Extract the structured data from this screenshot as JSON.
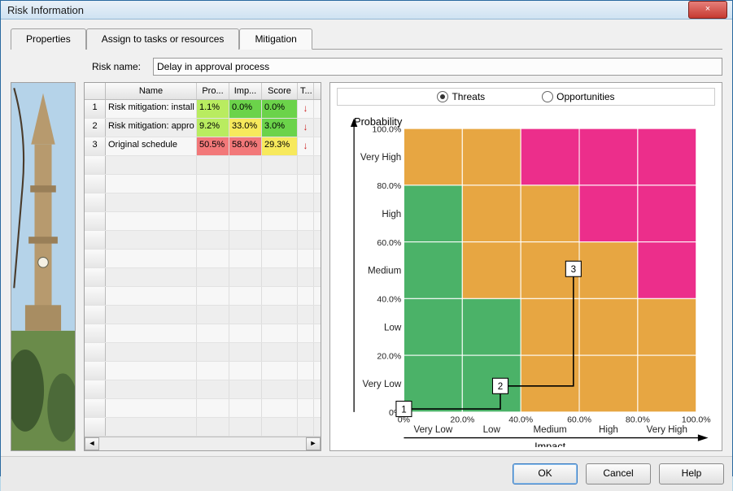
{
  "window": {
    "title": "Risk Information",
    "close_icon": "×"
  },
  "tabs": {
    "properties": "Properties",
    "assign": "Assign to tasks or resources",
    "mitigation": "Mitigation"
  },
  "form": {
    "risk_name_label": "Risk name:",
    "risk_name_value": "Delay in approval process"
  },
  "grid": {
    "headers": {
      "name": "Name",
      "pro": "Pro...",
      "imp": "Imp...",
      "score": "Score",
      "t": "T..."
    },
    "rows": [
      {
        "num": "1",
        "name": "Risk mitigation: install",
        "pro": "1.1%",
        "imp": "0.0%",
        "score": "0.0%",
        "pro_class": "cell-lime",
        "imp_class": "cell-green",
        "score_class": "cell-green"
      },
      {
        "num": "2",
        "name": "Risk mitigation: appro",
        "pro": "9.2%",
        "imp": "33.0%",
        "score": "3.0%",
        "pro_class": "cell-lime",
        "imp_class": "cell-yellow",
        "score_class": "cell-green"
      },
      {
        "num": "3",
        "name": "Original schedule",
        "pro": "50.5%",
        "imp": "58.0%",
        "score": "29.3%",
        "pro_class": "cell-red",
        "imp_class": "cell-red",
        "score_class": "cell-yellow"
      }
    ],
    "arrow": "↓"
  },
  "matrix": {
    "radio_threats": "Threats",
    "radio_opportunities": "Opportunities",
    "selected": "threats"
  },
  "chart_data": {
    "type": "heatmap",
    "title": "",
    "xlabel": "Impact",
    "ylabel": "Probability",
    "x_categories": [
      "Very Low",
      "Low",
      "Medium",
      "High",
      "Very High"
    ],
    "y_categories": [
      "Very Low",
      "Low",
      "Medium",
      "High",
      "Very High"
    ],
    "x_ticks_pct": [
      "0%",
      "20.0%",
      "40.0%",
      "60.0%",
      "80.0%",
      "100.0%"
    ],
    "y_ticks_pct": [
      "0%",
      "20.0%",
      "40.0%",
      "60.0%",
      "80.0%",
      "100.0%"
    ],
    "colors": {
      "green": "#4bb268",
      "orange": "#e7a642",
      "magenta": "#ec2e8b"
    },
    "matrix": [
      [
        "green",
        "green",
        "orange",
        "orange",
        "orange"
      ],
      [
        "green",
        "green",
        "orange",
        "orange",
        "orange"
      ],
      [
        "green",
        "orange",
        "orange",
        "orange",
        "magenta"
      ],
      [
        "green",
        "orange",
        "orange",
        "magenta",
        "magenta"
      ],
      [
        "orange",
        "orange",
        "magenta",
        "magenta",
        "magenta"
      ]
    ],
    "points": [
      {
        "label": "1",
        "impact_pct": 0.0,
        "prob_pct": 1.1
      },
      {
        "label": "2",
        "impact_pct": 33.0,
        "prob_pct": 9.2
      },
      {
        "label": "3",
        "impact_pct": 58.0,
        "prob_pct": 50.5
      }
    ]
  },
  "buttons": {
    "ok": "OK",
    "cancel": "Cancel",
    "help": "Help"
  }
}
